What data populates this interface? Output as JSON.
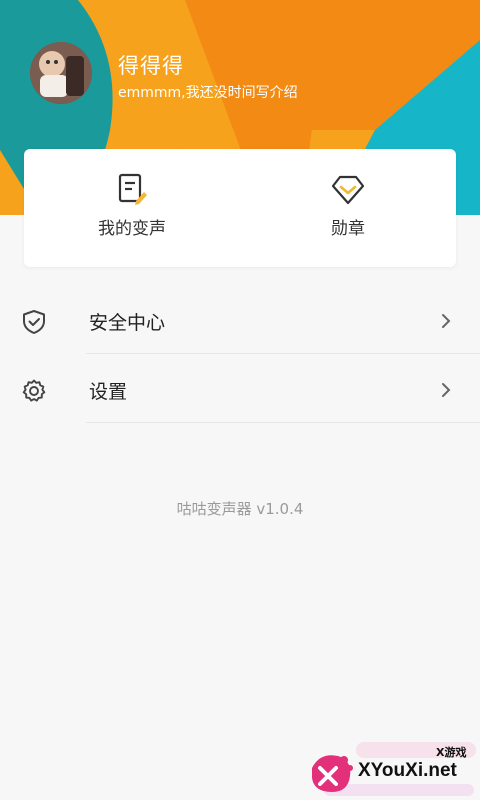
{
  "profile": {
    "nickname": "得得得",
    "bio": "emmmm,我还没时间写介绍"
  },
  "quick_actions": [
    {
      "label": "我的变声",
      "icon": "voice-note-icon"
    },
    {
      "label": "勋章",
      "icon": "medal-icon"
    }
  ],
  "menu": [
    {
      "label": "安全中心",
      "icon": "shield-icon"
    },
    {
      "label": "设置",
      "icon": "gear-icon"
    }
  ],
  "footer": {
    "version": "咕咕变声器 v1.0.4"
  },
  "watermark": {
    "site": "XYouXi.net",
    "tag": "X游戏"
  },
  "colors": {
    "orange": "#f7a21d",
    "deep_orange": "#f28a14",
    "teal": "#1a9a9b",
    "cyan": "#16b5c7",
    "accent_yellow": "#f5b731"
  }
}
